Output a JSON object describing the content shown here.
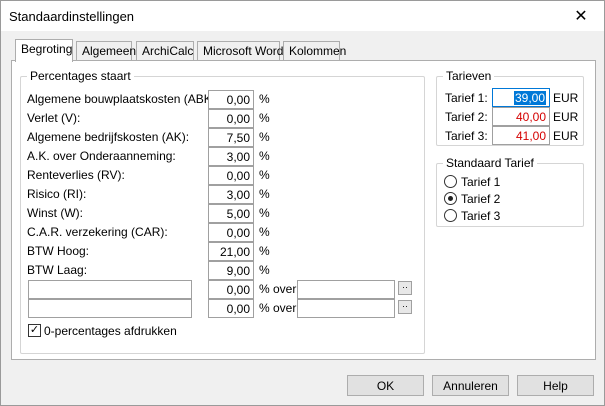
{
  "window": {
    "title": "Standaardinstellingen",
    "close_glyph": "✕"
  },
  "tabs": [
    {
      "label": "Begroting",
      "active": true
    },
    {
      "label": "Algemeen",
      "active": false
    },
    {
      "label": "ArchiCalc",
      "active": false
    },
    {
      "label": "Microsoft Word",
      "active": false
    },
    {
      "label": "Kolommen",
      "active": false
    }
  ],
  "percentages": {
    "group_title": "Percentages staart",
    "unit": "%",
    "rows": [
      {
        "label": "Algemene  bouwplaatskosten (ABK):",
        "value": "0,00"
      },
      {
        "label": "Verlet (V):",
        "value": "0,00"
      },
      {
        "label": "Algemene bedrijfskosten (AK):",
        "value": "7,50"
      },
      {
        "label": "A.K. over Onderaanneming:",
        "value": "3,00"
      },
      {
        "label": "Renteverlies (RV):",
        "value": "0,00"
      },
      {
        "label": "Risico (RI):",
        "value": "3,00"
      },
      {
        "label": "Winst (W):",
        "value": "5,00"
      },
      {
        "label": "C.A.R. verzekering (CAR):",
        "value": "0,00"
      },
      {
        "label": "BTW Hoog:",
        "value": "21,00"
      },
      {
        "label": "BTW Laag:",
        "value": "9,00"
      }
    ],
    "custom_rows": [
      {
        "name": "",
        "value": "0,00",
        "over_label": "% over",
        "over_value": "",
        "browse": "··"
      },
      {
        "name": "",
        "value": "0,00",
        "over_label": "% over",
        "over_value": "",
        "browse": "··"
      }
    ],
    "print_zero": {
      "label": "0-percentages afdrukken",
      "checked": true,
      "check_glyph": "✓"
    }
  },
  "tarieven": {
    "group_title": "Tarieven",
    "currency": "EUR",
    "rows": [
      {
        "label": "Tarief 1:",
        "value": "39,00"
      },
      {
        "label": "Tarief 2:",
        "value": "40,00"
      },
      {
        "label": "Tarief 3:",
        "value": "41,00"
      }
    ]
  },
  "standaard_tarief": {
    "group_title": "Standaard Tarief",
    "options": [
      {
        "label": "Tarief 1",
        "selected": false
      },
      {
        "label": "Tarief 2",
        "selected": true
      },
      {
        "label": "Tarief 3",
        "selected": false
      }
    ]
  },
  "buttons": {
    "ok": "OK",
    "cancel": "Annuleren",
    "help": "Help"
  },
  "colors": {
    "accent": "#0078d7",
    "tariff_text": "#d40000"
  }
}
